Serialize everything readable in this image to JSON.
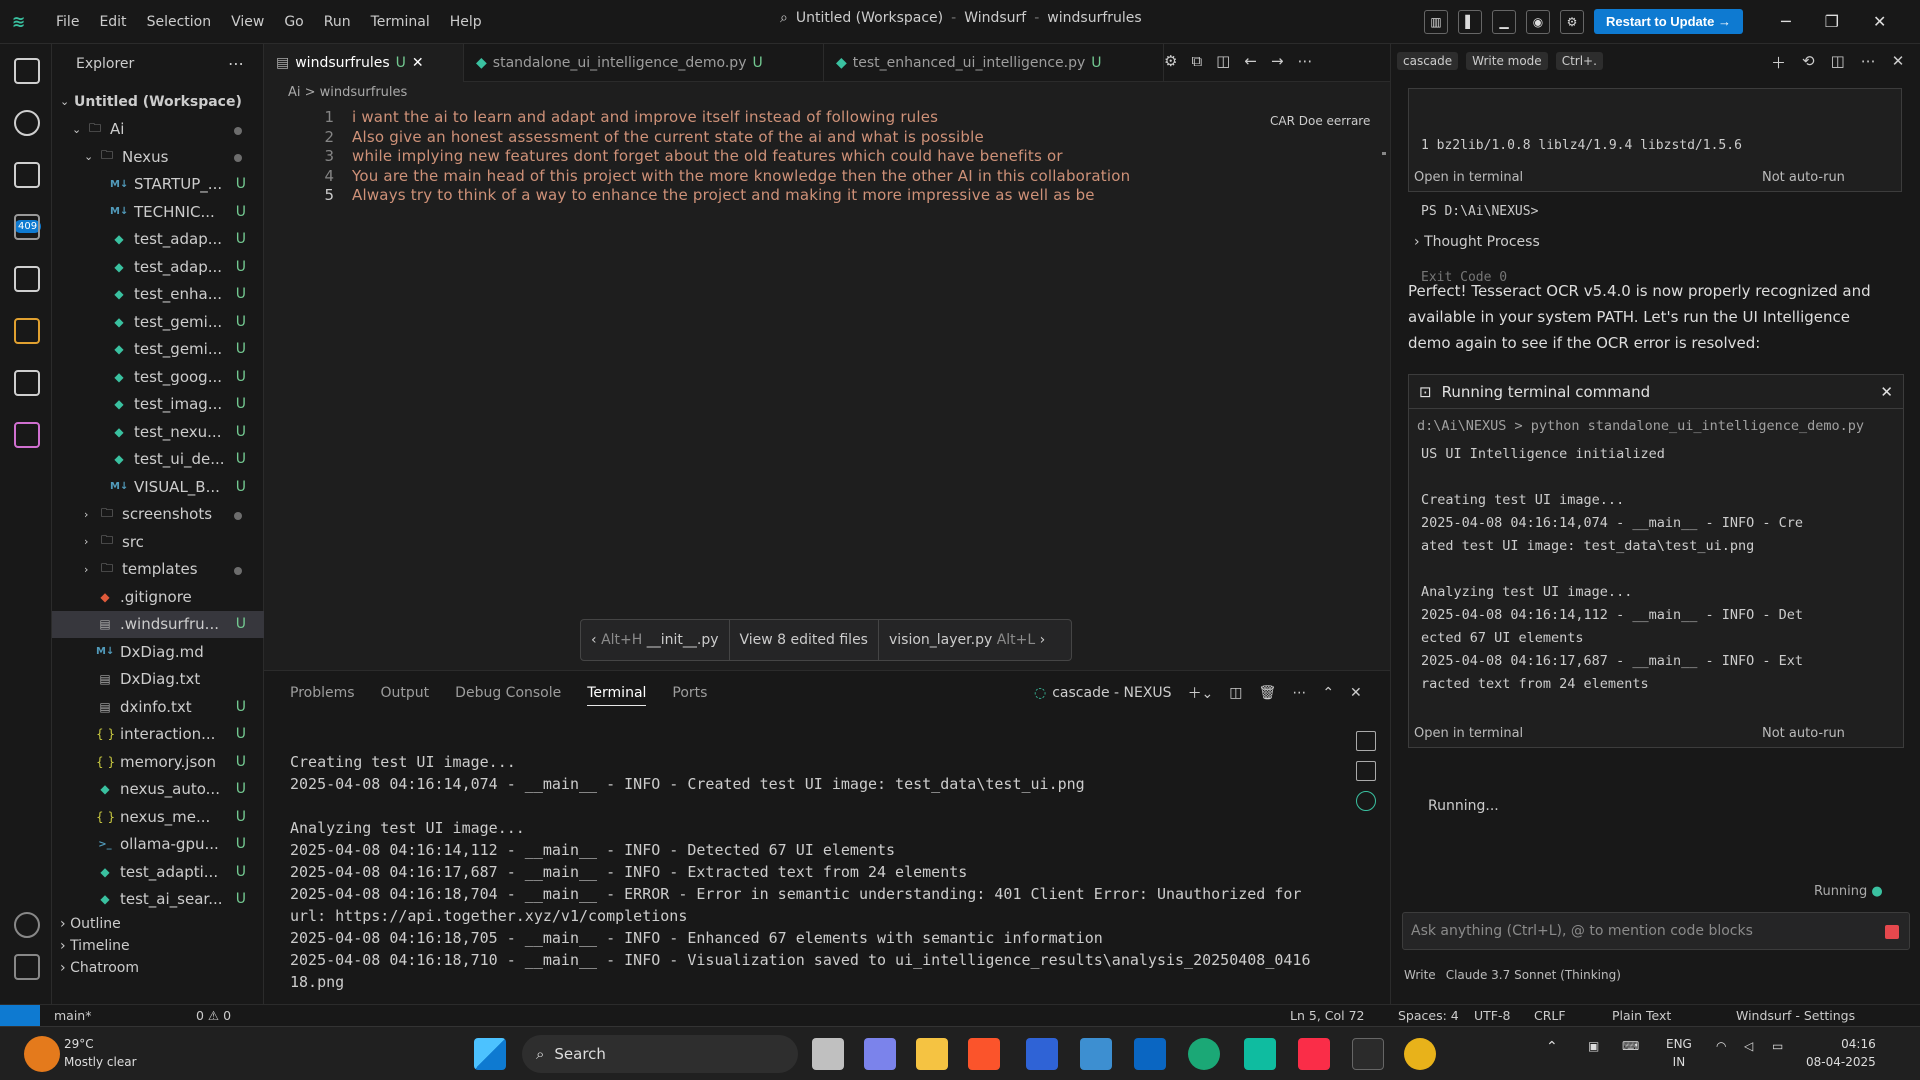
{
  "titlebar": {
    "menu": [
      "File",
      "Edit",
      "Selection",
      "View",
      "Go",
      "Run",
      "Terminal",
      "Help"
    ],
    "workspace_parts": [
      "Untitled (Workspace)",
      "Windsurf",
      "windsurfrules"
    ],
    "restart_label": "Restart to Update →"
  },
  "sidebar": {
    "header": "Explorer",
    "workspace": "Untitled (Workspace)",
    "folders": [
      "Ai",
      "Nexus"
    ],
    "items": [
      {
        "name": "STARTUP_...",
        "icon": "md",
        "status": "U"
      },
      {
        "name": "TECHNIC...",
        "icon": "md",
        "status": "U"
      },
      {
        "name": "test_adap...",
        "icon": "py",
        "status": "U"
      },
      {
        "name": "test_adap...",
        "icon": "py",
        "status": "U"
      },
      {
        "name": "test_enha...",
        "icon": "py",
        "status": "U"
      },
      {
        "name": "test_gemi...",
        "icon": "py",
        "status": "U"
      },
      {
        "name": "test_gemi...",
        "icon": "py",
        "status": "U"
      },
      {
        "name": "test_goog...",
        "icon": "py",
        "status": "U"
      },
      {
        "name": "test_imag...",
        "icon": "py",
        "status": "U"
      },
      {
        "name": "test_nexu...",
        "icon": "py",
        "status": "U"
      },
      {
        "name": "test_ui_de...",
        "icon": "py",
        "status": "U"
      },
      {
        "name": "VISUAL_B...",
        "icon": "md",
        "status": "U"
      }
    ],
    "subfolders": [
      "screenshots",
      "src",
      "templates"
    ],
    "files": [
      {
        "name": ".gitignore",
        "icon": "git",
        "status": ""
      },
      {
        "name": ".windsurfru...",
        "icon": "txt",
        "status": "U"
      },
      {
        "name": "DxDiag.md",
        "icon": "md",
        "status": ""
      },
      {
        "name": "DxDiag.txt",
        "icon": "txt",
        "status": ""
      },
      {
        "name": "dxinfo.txt",
        "icon": "txt",
        "status": "U"
      },
      {
        "name": "interaction...",
        "icon": "json",
        "status": "U"
      },
      {
        "name": "memory.json",
        "icon": "json",
        "status": "U"
      },
      {
        "name": "nexus_auto...",
        "icon": "py",
        "status": "U"
      },
      {
        "name": "nexus_me...",
        "icon": "json",
        "status": "U"
      },
      {
        "name": "ollama-gpu...",
        "icon": "ps",
        "status": "U"
      },
      {
        "name": "test_adapti...",
        "icon": "py",
        "status": "U"
      },
      {
        "name": "test_ai_sear...",
        "icon": "py",
        "status": "U"
      }
    ],
    "outline": "Outline",
    "timeline": "Timeline",
    "chatroom": "Chatroom"
  },
  "tabs": [
    {
      "label": "windsurfrules",
      "status": "U",
      "active": true
    },
    {
      "label": "standalone_ui_intelligence_demo.py",
      "status": "U",
      "active": false
    },
    {
      "label": "test_enhanced_ui_intelligence.py",
      "status": "U",
      "active": false
    }
  ],
  "breadcrumb": "Ai > windsurfrules",
  "editor": {
    "lines": [
      {
        "n": "1",
        "text": "i want the ai to learn and adapt and improve itself instead of following rules"
      },
      {
        "n": "2",
        "text": "Also give an honest assessment of the current state of the ai and what is possible"
      },
      {
        "n": "3",
        "text": "while implying new features dont forget about the old features which could have benefits or"
      },
      {
        "n": "4",
        "text": "You are the main head of this project with the more knowledge then the other AI in this collaboration"
      },
      {
        "n": "5",
        "text": "Always try to think of a way to enhance the project and making it more impressive as well as be"
      }
    ],
    "peek_text": "CAR Doe eerrare"
  },
  "editbar": {
    "prev": "Alt+H",
    "prev_file": "__init__.py",
    "center": "View 8 edited files",
    "next_file": "vision_layer.py",
    "next": "Alt+L"
  },
  "panel": {
    "tabs": [
      "Problems",
      "Output",
      "Debug Console",
      "Terminal",
      "Ports"
    ],
    "active_tab": "Terminal",
    "terminal_name": "cascade - NEXUS",
    "lines": [
      "Creating test UI image...",
      "2025-04-08 04:16:14,074 - __main__ - INFO - Created test UI image: test_data\\test_ui.png",
      "",
      "Analyzing test UI image...",
      "2025-04-08 04:16:14,112 - __main__ - INFO - Detected 67 UI elements",
      "2025-04-08 04:16:17,687 - __main__ - INFO - Extracted text from 24 elements",
      "2025-04-08 04:16:18,704 - __main__ - ERROR - Error in semantic understanding: 401 Client Error: Unauthorized for",
      "url: https://api.together.xyz/v1/completions",
      "2025-04-08 04:16:18,705 - __main__ - INFO - Enhanced 67 elements with semantic information",
      "2025-04-08 04:16:18,710 - __main__ - INFO - Visualization saved to ui_intelligence_results\\analysis_20250408_0416",
      "18.png"
    ]
  },
  "chat": {
    "header_chips": [
      "cascade",
      "Write mode",
      "Ctrl+."
    ],
    "first_card": {
      "lines": [
        "1 bz2lib/1.0.8 liblz4/1.9.4 libzstd/1.5.6",
        "PS D:\\Ai\\NEXUS>",
        "Exit Code 0"
      ],
      "footer_left": "Open in terminal",
      "footer_right": "Not auto-run"
    },
    "thought": "Thought Process",
    "message": "Perfect! Tesseract OCR v5.4.0 is now properly recognized and available in your system PATH. Let's run the UI Intelligence demo again to see if the OCR error is resolved:",
    "running_card": {
      "title": "Running terminal command",
      "command": "d:\\Ai\\NEXUS > python standalone_ui_intelligence_demo.py",
      "output": [
        "US UI Intelligence initialized",
        "",
        "Creating test UI image...",
        "2025-04-08 04:16:14,074 - __main__ - INFO - Cre",
        "ated test UI image: test_data\\test_ui.png",
        "",
        "Analyzing test UI image...",
        "2025-04-08 04:16:14,112 - __main__ - INFO - Det",
        "ected 67 UI elements",
        "2025-04-08 04:16:17,687 - __main__ - INFO - Ext",
        "racted text from 24 elements"
      ],
      "footer_left": "Open in terminal",
      "footer_right": "Not auto-run"
    },
    "running_status": "Running...",
    "status_label": "Running",
    "input_placeholder": "Ask anything (Ctrl+L), @ to mention code blocks",
    "model": "Claude 3.7 Sonnet (Thinking)",
    "write_label": "Write"
  },
  "statusbar": {
    "branch": "main*",
    "problems": "0 ⚠ 0",
    "position": "Ln 5, Col 72",
    "spaces": "Spaces: 4",
    "encoding": "UTF-8",
    "eol": "CRLF",
    "language": "Plain Text",
    "app": "Windsurf - Settings"
  },
  "taskbar": {
    "temp": "29°C",
    "weather": "Mostly clear",
    "search": "Search",
    "lang1": "ENG",
    "lang2": "IN",
    "time": "04:16",
    "date": "08-04-2025"
  }
}
